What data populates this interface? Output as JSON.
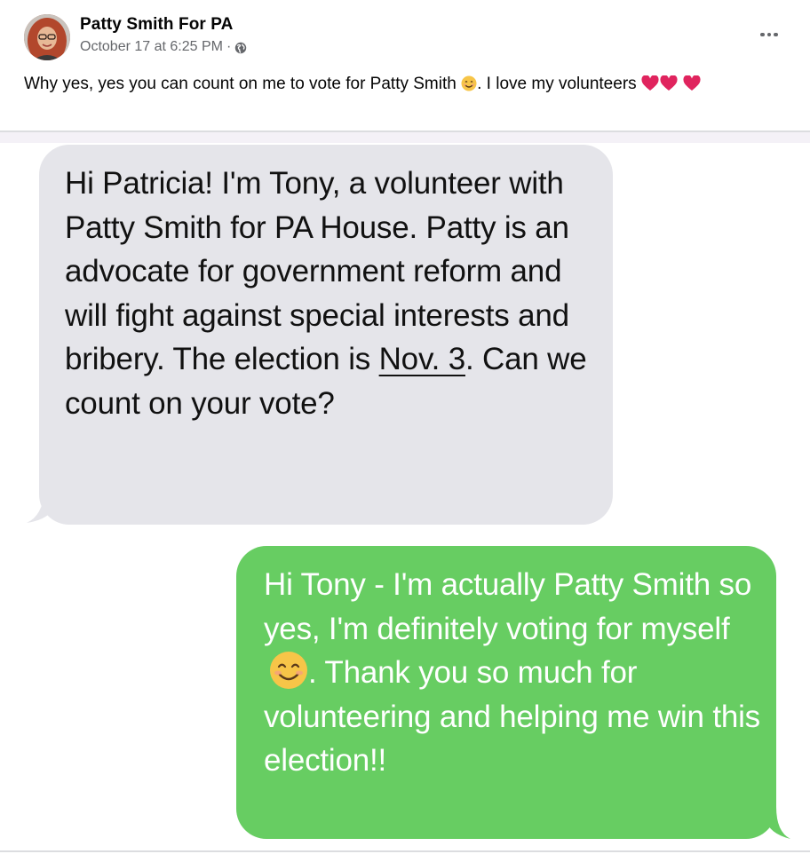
{
  "post": {
    "author": "Patty Smith For PA",
    "timestamp": "October 17 at 6:25 PM",
    "separator": "·",
    "privacy_icon": "globe-icon",
    "more_icon": "more-options-icon",
    "caption": {
      "text_before_emoji": "Why yes, yes you can count on me to vote for Patty Smith",
      "text_after_emoji": ". I love my volunteers",
      "emojis": [
        "smiling-face-icon",
        "heart-icon",
        "heart-icon",
        "heart-icon"
      ]
    }
  },
  "screenshot": {
    "incoming_message": {
      "part1": "Hi Patricia! I'm Tony, a volunteer with Patty Smith for PA House. Patty is an advocate for government reform and will fight against special interests and bribery.  The election is ",
      "link_text": "Nov. 3",
      "part2": ". Can we count on your vote?"
    },
    "outgoing_message": {
      "part1": "Hi Tony - I'm actually Patty Smith so yes, I'm definitely voting for myself",
      "emoji": "smiling-face-icon",
      "part2": ". Thank you so much for volunteering and helping me win this election!!"
    }
  },
  "colors": {
    "incoming_bubble": "#e5e5ea",
    "outgoing_bubble": "#67cd62",
    "heart": "#e0245e",
    "meta_text": "#65676b"
  }
}
